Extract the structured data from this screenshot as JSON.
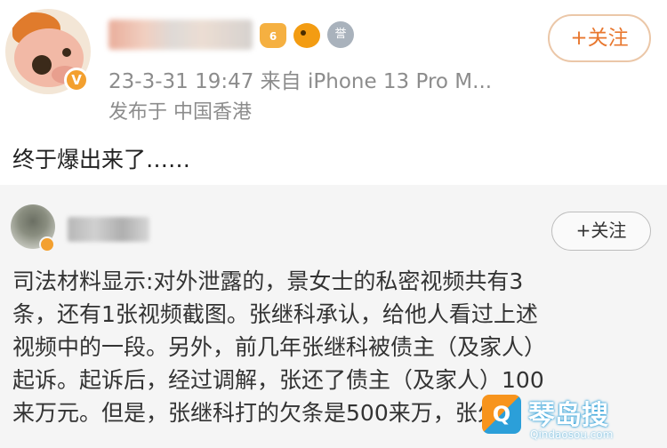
{
  "post": {
    "meta": "23-3-31 19:47  来自 iPhone 13 Pro M...",
    "location": "发布于 中国香港",
    "follow_label": "+关注",
    "text": "终于爆出来了……",
    "verified_mark": "V"
  },
  "badges": {
    "crown_text": "6",
    "medal_text": "誉"
  },
  "repost": {
    "follow_label": "+关注",
    "lines": [
      "司法材料显示:对外泄露的，景女士的私密视频共有3",
      "条，还有1张视频截图。张继科承认，给他人看过上述",
      "视频中的一段。另外，前几年张继科被债主（及家人）",
      "起诉。起诉后，经过调解，张还了债主（及家人）100",
      "来万元。但是，张继科打的欠条是500来万，张欠"
    ]
  },
  "watermark": {
    "logo_text": "Q",
    "title": "琴岛搜",
    "url": "Qindaosou.com"
  },
  "colors": {
    "accent": "#e8772e",
    "verified": "#f3a02f",
    "meta_gray": "#8c8c8c",
    "card_bg": "#f5f5f5"
  }
}
